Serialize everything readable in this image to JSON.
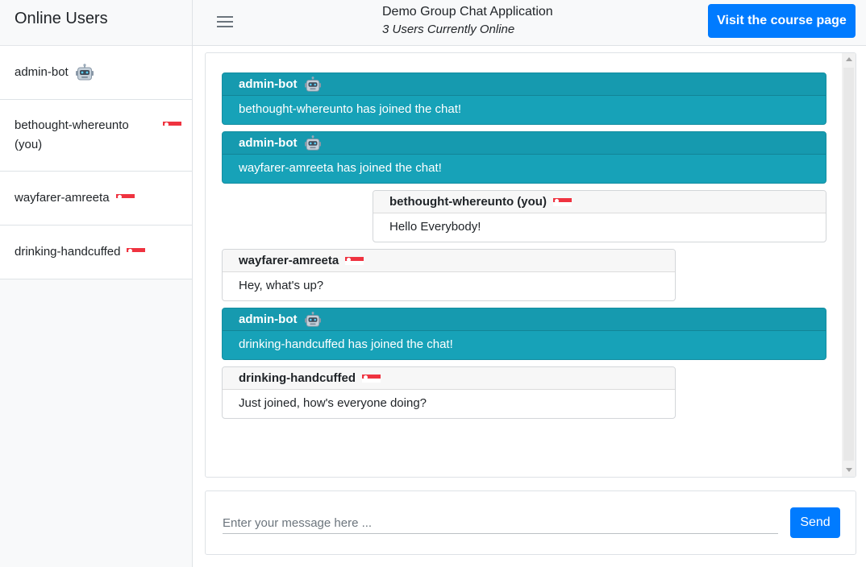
{
  "sidebar": {
    "title": "Online Users",
    "users": [
      {
        "name": "admin-bot",
        "icon": "robot-icon"
      },
      {
        "name": "bethought-whereunto (you)",
        "icon": "singapore-flag-icon"
      },
      {
        "name": "wayfarer-amreeta",
        "icon": "singapore-flag-icon"
      },
      {
        "name": "drinking-handcuffed",
        "icon": "singapore-flag-icon"
      }
    ]
  },
  "header": {
    "title": "Demo Group Chat Application",
    "subtitle": "3 Users Currently Online",
    "course_button_label": "Visit the course page"
  },
  "messages": [
    {
      "sender": "admin-bot",
      "type": "bot",
      "icon": "robot-icon",
      "text": "bethought-whereunto has joined the chat!"
    },
    {
      "sender": "admin-bot",
      "type": "bot",
      "icon": "robot-icon",
      "text": "wayfarer-amreeta has joined the chat!"
    },
    {
      "sender": "bethought-whereunto (you)",
      "type": "self",
      "icon": "singapore-flag-icon",
      "text": "Hello Everybody!"
    },
    {
      "sender": "wayfarer-amreeta",
      "type": "other",
      "icon": "singapore-flag-icon",
      "text": "Hey, what's up?"
    },
    {
      "sender": "admin-bot",
      "type": "bot",
      "icon": "robot-icon",
      "text": "drinking-handcuffed has joined the chat!"
    },
    {
      "sender": "drinking-handcuffed",
      "type": "other",
      "icon": "singapore-flag-icon",
      "text": "Just joined, how's everyone doing?"
    }
  ],
  "composer": {
    "placeholder": "Enter your message here ...",
    "value": "",
    "send_label": "Send"
  },
  "colors": {
    "primary": "#007bff",
    "bot_message": "#17a2b8",
    "sidebar_bg": "#f8f9fa"
  }
}
